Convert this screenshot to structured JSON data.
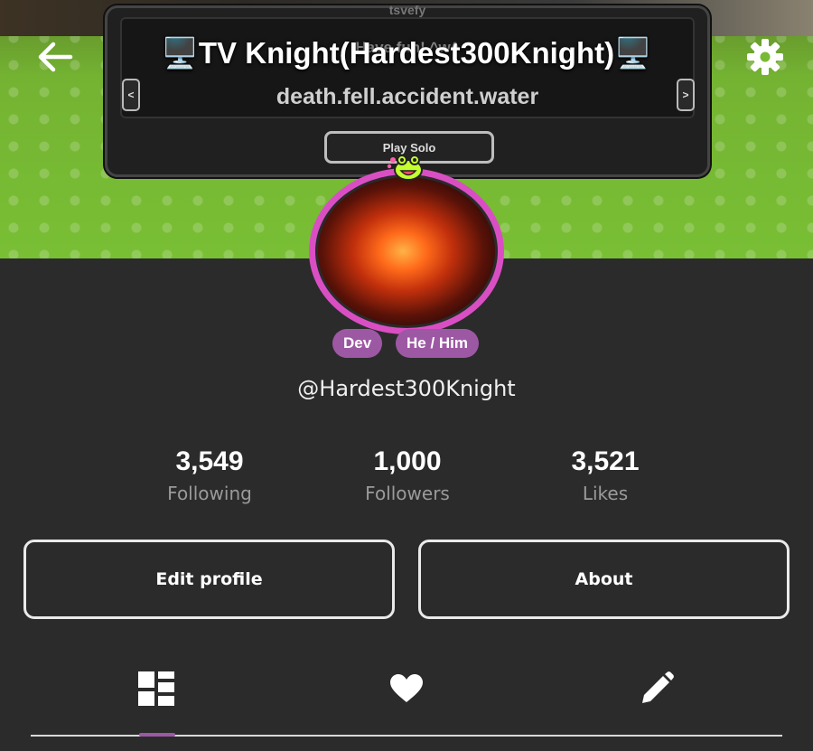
{
  "banner": {
    "top_text": "tsvefy",
    "panel_text": "Have fun! ^w^",
    "panel_subtitle": "death.fell.accident.water",
    "left_arrow": "<",
    "right_arrow": ">",
    "play_solo": "Play Solo"
  },
  "header": {
    "title": "🖥️TV Knight(Hardest300Knight)🖥️"
  },
  "profile": {
    "badges": [
      "Dev",
      "He / Him"
    ],
    "username": "@Hardest300Knight",
    "ring_color": "#d94fc3",
    "badge_color": "#9d58a3"
  },
  "stats": [
    {
      "value": "3,549",
      "label": "Following"
    },
    {
      "value": "1,000",
      "label": "Followers"
    },
    {
      "value": "3,521",
      "label": "Likes"
    }
  ],
  "actions": {
    "edit_profile": "Edit profile",
    "about": "About"
  },
  "tabs": [
    {
      "icon": "grid-icon",
      "active": true
    },
    {
      "icon": "heart-icon",
      "active": false
    },
    {
      "icon": "pencil-icon",
      "active": false
    }
  ],
  "colors": {
    "background": "#2b2b2b",
    "accent": "#9d58a3"
  }
}
